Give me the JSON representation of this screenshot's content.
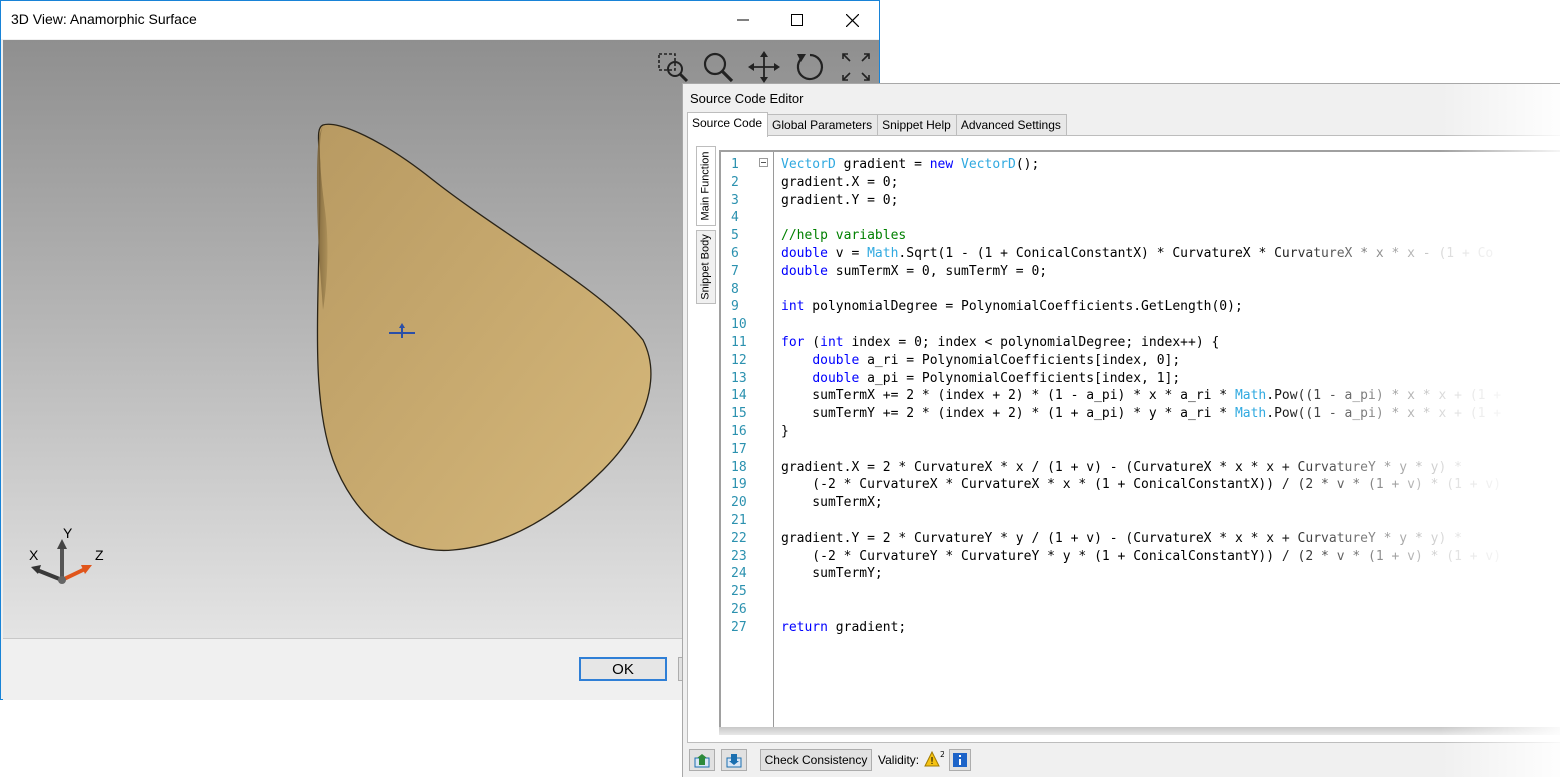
{
  "view3d": {
    "title": "3D View: Anamorphic Surface",
    "caption_buttons": [
      "minimize-icon",
      "maximize-icon",
      "close-icon"
    ],
    "toolbar_icons": [
      "zoom-window-icon",
      "zoom-icon",
      "pan-icon",
      "rotate-icon",
      "fit-view-icon"
    ],
    "axes": {
      "x": "X",
      "y": "Y",
      "z": "Z"
    },
    "surface_color": "#c8a86a",
    "ok_label": "OK"
  },
  "editor": {
    "title": "Source Code Editor",
    "tabs": [
      "Source Code",
      "Global Parameters",
      "Snippet Help",
      "Advanced Settings"
    ],
    "active_tab": "Source Code",
    "side_tabs": [
      "Main Function",
      "Snippet Body"
    ],
    "lines": [
      "VectorD gradient = new VectorD();",
      "gradient.X = 0;",
      "gradient.Y = 0;",
      "",
      "//help variables",
      "double v = Math.Sqrt(1 - (1 + ConicalConstantX) * CurvatureX * CurvatureX * x * x - (1 + Co",
      "double sumTermX = 0, sumTermY = 0;",
      "",
      "int polynomialDegree = PolynomialCoefficients.GetLength(0);",
      "",
      "for (int index = 0; index < polynomialDegree; index++) {",
      "    double a_ri = PolynomialCoefficients[index, 0];",
      "    double a_pi = PolynomialCoefficients[index, 1];",
      "    sumTermX += 2 * (index + 2) * (1 - a_pi) * x * a_ri * Math.Pow((1 - a_pi) * x * x + (1 +",
      "    sumTermY += 2 * (index + 2) * (1 + a_pi) * y * a_ri * Math.Pow((1 - a_pi) * x * x + (1 +",
      "}",
      "",
      "gradient.X = 2 * CurvatureX * x / (1 + v) - (CurvatureX * x * x + CurvatureY * y * y) *",
      "    (-2 * CurvatureX * CurvatureX * x * (1 + ConicalConstantX)) / (2 * v * (1 + v) * (1 + v)",
      "    sumTermX;",
      "",
      "gradient.Y = 2 * CurvatureY * y / (1 + v) - (CurvatureX * x * x + CurvatureY * y * y) *",
      "    (-2 * CurvatureY * CurvatureY * y * (1 + ConicalConstantY)) / (2 * v * (1 + v) * (1 + v)",
      "    sumTermY;",
      "",
      "",
      "return gradient;"
    ],
    "footer": {
      "check_label": "Check Consistency",
      "validity_label": "Validity:",
      "icons": [
        "import-icon",
        "export-icon",
        "warning-icon",
        "info-icon"
      ]
    }
  }
}
